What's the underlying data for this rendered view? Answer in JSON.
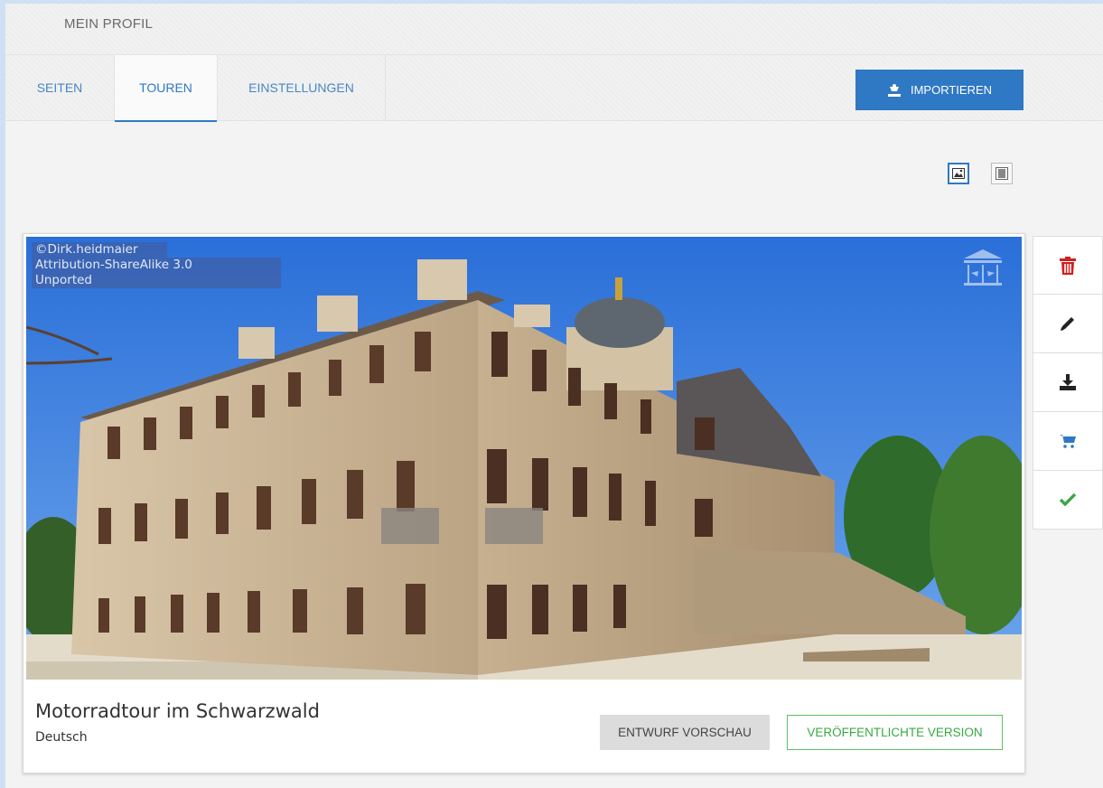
{
  "profile": {
    "title": "MEIN PROFIL"
  },
  "tabs": [
    {
      "label": "SEITEN",
      "active": false
    },
    {
      "label": "TOUREN",
      "active": true
    },
    {
      "label": "EINSTELLUNGEN",
      "active": false
    }
  ],
  "toolbar": {
    "import_label": "IMPORTIEREN"
  },
  "view_toggle": {
    "selected": "grid",
    "options": [
      "grid-view-icon",
      "list-view-icon"
    ]
  },
  "tour": {
    "title": "Motorradtour im Schwarzwald",
    "language": "Deutsch",
    "image_credit": [
      "©Dirk.heidmaier",
      "Attribution-ShareAlike 3.0",
      "Unported"
    ],
    "draft_preview_label": "ENTWURF VORSCHAU",
    "published_label": "VERÖFFENTLICHTE VERSION"
  },
  "actions": [
    {
      "icon": "trash-icon",
      "color": "#d0201e"
    },
    {
      "icon": "pencil-icon",
      "color": "#222222"
    },
    {
      "icon": "download-icon",
      "color": "#222222"
    },
    {
      "icon": "cart-icon",
      "color": "#2f78c4"
    },
    {
      "icon": "checkmark-icon",
      "color": "#3aa843"
    }
  ],
  "colors": {
    "accent": "#2f78c4",
    "success": "#3aa843",
    "danger": "#d0201e"
  }
}
